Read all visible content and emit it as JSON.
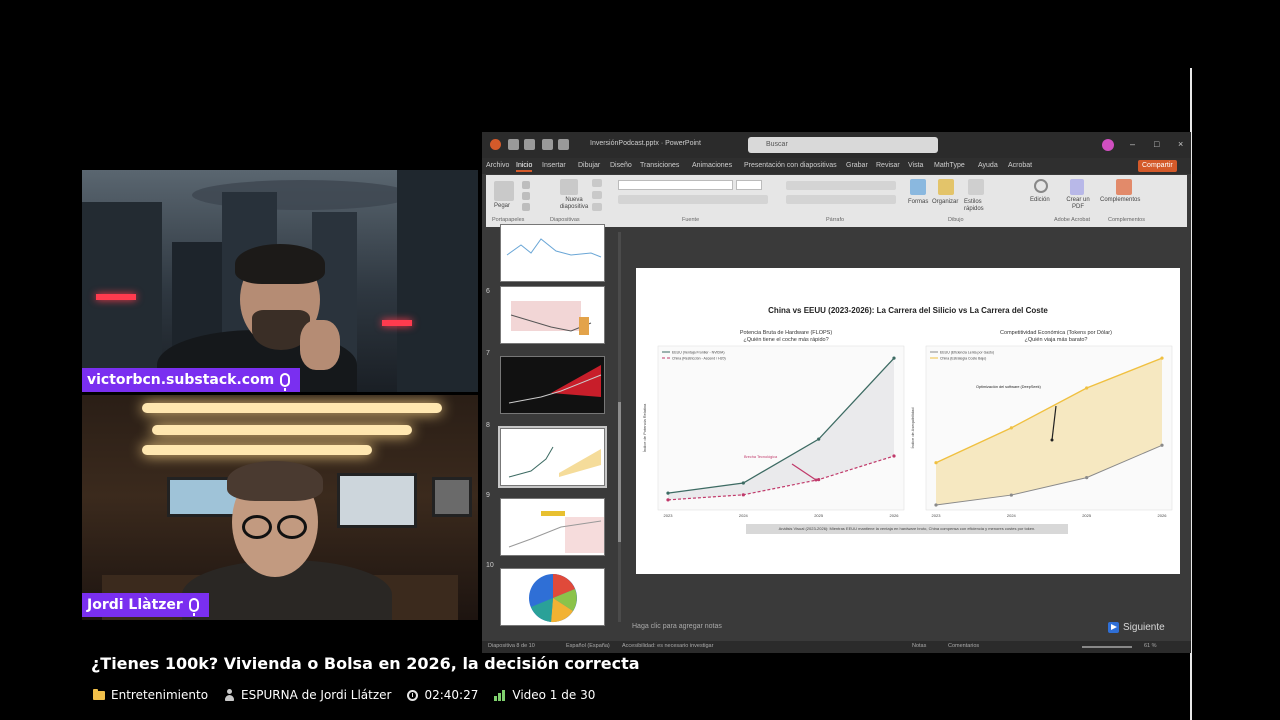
{
  "webcams": [
    {
      "name_tag": "victorbcn.substack.com"
    },
    {
      "name_tag": "Jordi Llàtzer"
    }
  ],
  "ppt": {
    "filename": "InversiónPodcast.pptx · PowerPoint",
    "search_placeholder": "Buscar",
    "menu": [
      "Archivo",
      "Inicio",
      "Insertar",
      "Dibujar",
      "Diseño",
      "Transiciones",
      "Animaciones",
      "Presentación con diapositivas",
      "Grabar",
      "Revisar",
      "Vista",
      "MathType",
      "Ayuda",
      "Acrobat"
    ],
    "active_menu_index": 1,
    "share_label": "Compartir",
    "ribbon": {
      "paste": "Pegar",
      "new_slide": "Nueva diapositiva",
      "shapes": "Formas",
      "arrange": "Organizar",
      "quick_styles": "Estilos rápidos",
      "edit": "Edición",
      "create_pdf": "Crear un PDF",
      "addins": "Complementos",
      "groups": [
        "Portapapeles",
        "Diapositivas",
        "Fuente",
        "Párrafo",
        "Dibujo",
        "Adobe Acrobat",
        "Complementos"
      ]
    },
    "thumb_numbers": [
      "6",
      "7",
      "8",
      "9",
      "10"
    ],
    "slide": {
      "title": "China vs EEUU (2023-2026): La Carrera del Silicio vs La Carrera del Coste",
      "left_title": "Potencia Bruta de Hardware (FLOPS)",
      "left_subtitle": "¿Quién tiene el coche más rápido?",
      "right_title": "Competitividad Económica (Tokens por Dólar)",
      "right_subtitle": "¿Quién viaja más barato?",
      "left_legend": [
        "EEUU (Ventaja Frontier - NVIDIA)",
        "China (Restricción - Ascend / H20)"
      ],
      "right_legend": [
        "EEUU (Eficiencia Lenta por Gasto)",
        "China (Estrategia Coste Bajo)"
      ],
      "left_annotation": "Brecha Tecnológica",
      "right_annotation": "Optimización del software (DeepSeek)",
      "note": "Análisis Visual (2023-2026): Mientras EEUU mantiene la ventaja en hardware bruto, China compensa con eficiencia y menores costes por token."
    },
    "notes_placeholder": "Haga clic para agregar notas",
    "next_label": "Siguiente",
    "status": {
      "slide": "Diapositiva 8 de 10",
      "language": "Español (España)",
      "accessibility": "Accesibilidad: es necesario investigar",
      "notes": "Notas",
      "comments": "Comentarios",
      "zoom": "61 %"
    }
  },
  "chart_data": [
    {
      "type": "line",
      "title": "Potencia Bruta de Hardware (FLOPS)",
      "subtitle": "¿Quién tiene el coche más rápido?",
      "x": [
        "2023",
        "2024",
        "2025",
        "2026"
      ],
      "ylabel": "Índice de Potencia Relativa",
      "series": [
        {
          "name": "EEUU (Ventaja Frontier - NVIDIA)",
          "values": [
            100,
            160,
            420,
            900
          ]
        },
        {
          "name": "China (Restricción - Ascend / H20)",
          "values": [
            60,
            90,
            180,
            320
          ]
        }
      ]
    },
    {
      "type": "area",
      "title": "Competitividad Económica (Tokens por Dólar)",
      "subtitle": "¿Quién viaja más barato?",
      "x": [
        "2023",
        "2024",
        "2025",
        "2026"
      ],
      "ylabel": "Índice de Asequibilidad",
      "series": [
        {
          "name": "EEUU (Eficiencia Lenta por Gasto)",
          "values": [
            10,
            30,
            65,
            130
          ]
        },
        {
          "name": "China (Estrategia Coste Bajo)",
          "values": [
            95,
            165,
            245,
            305
          ]
        }
      ]
    }
  ],
  "video": {
    "title": "¿Tienes 100k? Vivienda o Bolsa en 2026, la decisión correcta",
    "category": "Entretenimiento",
    "channel": "ESPURNA de Jordi Llátzer",
    "duration": "02:40:27",
    "position": "Video 1 de 30"
  },
  "colors": {
    "us_line": "#3d6b63",
    "china_line": "#c0396a",
    "china_area": "#f0c040",
    "us_area": "#8a8a8a",
    "name_tag_bg": "#7a2ff0"
  }
}
